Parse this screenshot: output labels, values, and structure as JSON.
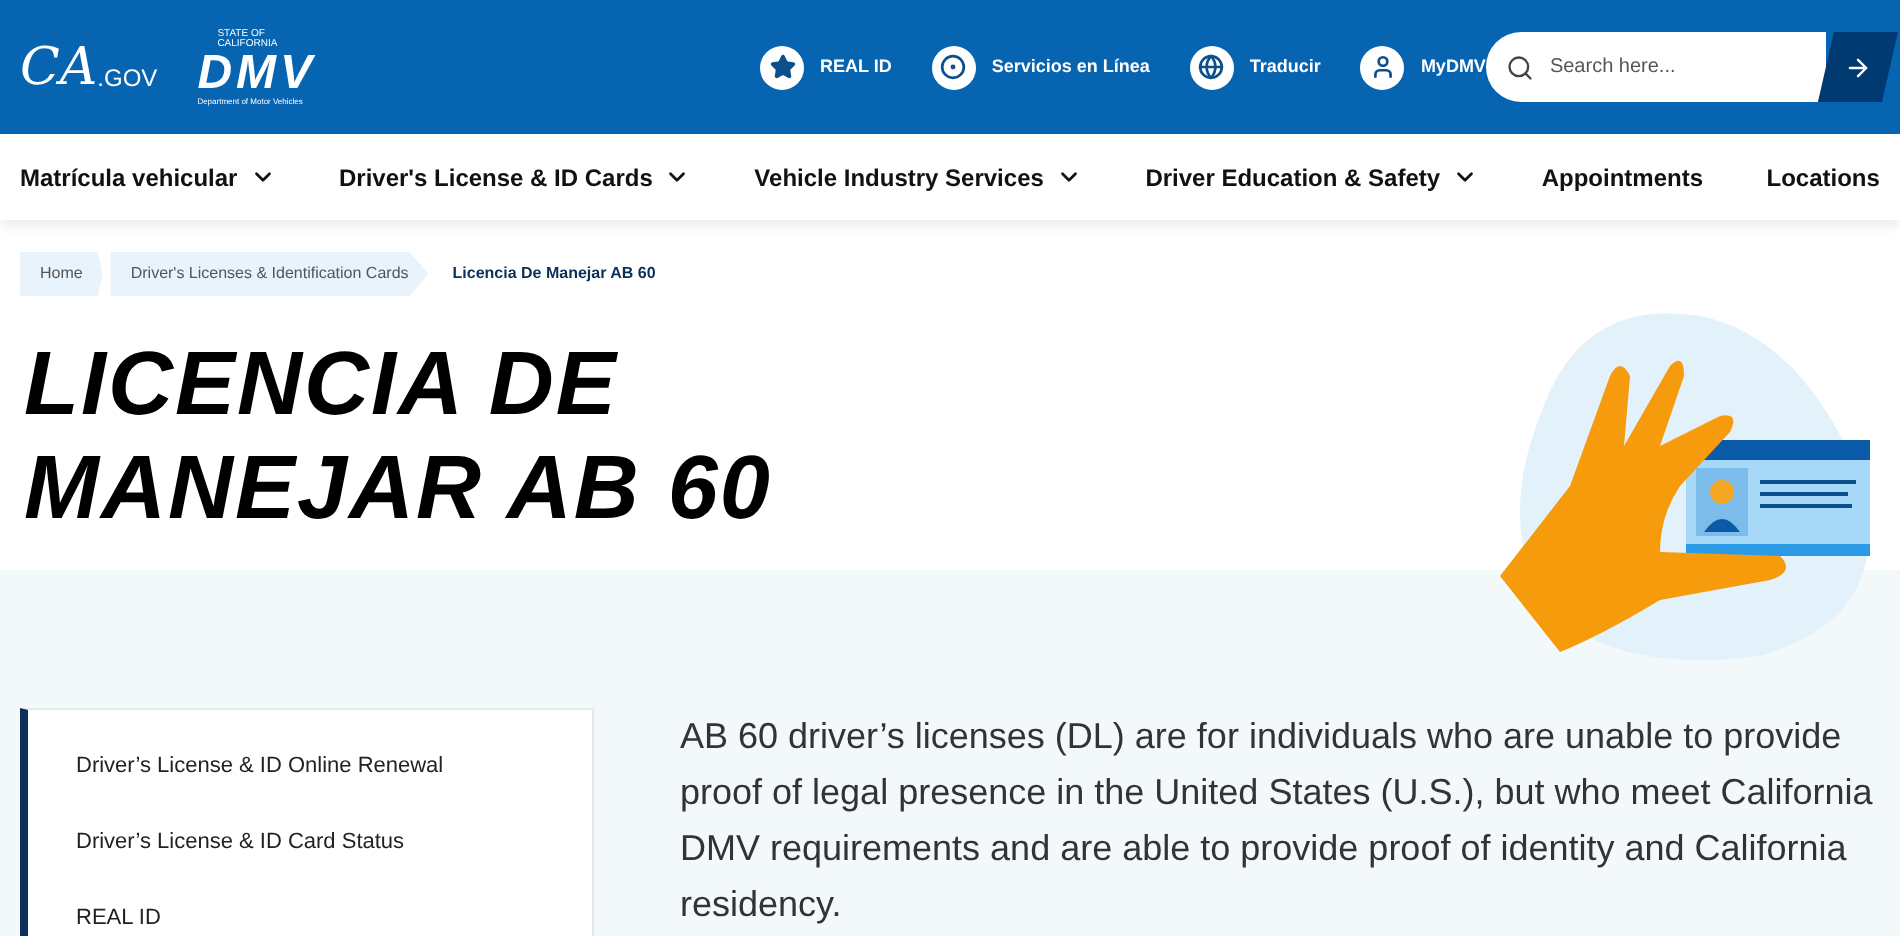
{
  "header": {
    "ca_logo": {
      "main": "CA",
      "suffix": ".GOV"
    },
    "dmv_logo": {
      "top": "STATE OF CALIFORNIA",
      "main": "DMV",
      "bottom": "Department of Motor Vehicles"
    },
    "links": [
      {
        "label": "REAL ID",
        "kind": "star"
      },
      {
        "label": "Servicios en Línea",
        "kind": "wheel"
      },
      {
        "label": "Traducir",
        "kind": "globe"
      },
      {
        "label": "MyDMV",
        "kind": "user"
      }
    ],
    "search": {
      "placeholder": "Search here..."
    }
  },
  "nav": [
    {
      "label": "Matrícula vehicular",
      "dropdown": true
    },
    {
      "label": "Driver's License & ID Cards",
      "dropdown": true
    },
    {
      "label": "Vehicle Industry Services",
      "dropdown": true
    },
    {
      "label": "Driver Education & Safety",
      "dropdown": true
    },
    {
      "label": "Appointments",
      "dropdown": false
    },
    {
      "label": "Locations",
      "dropdown": false
    }
  ],
  "breadcrumb": [
    {
      "label": "Home",
      "current": false
    },
    {
      "label": "Driver's Licenses & Identification Cards",
      "current": false
    },
    {
      "label": "Licencia De Manejar AB 60",
      "current": true
    }
  ],
  "title": "LICENCIA DE MANEJAR AB 60",
  "sidebar": {
    "items": [
      "Driver’s License & ID Online Renewal",
      "Driver’s License & ID Card Status",
      "REAL ID"
    ]
  },
  "intro": "AB 60 driver’s licenses (DL) are for individuals who are unable to provide proof of legal presence in the United States (U.S.), but who meet California DMV requirements and are able to provide proof of identity and California residency."
}
